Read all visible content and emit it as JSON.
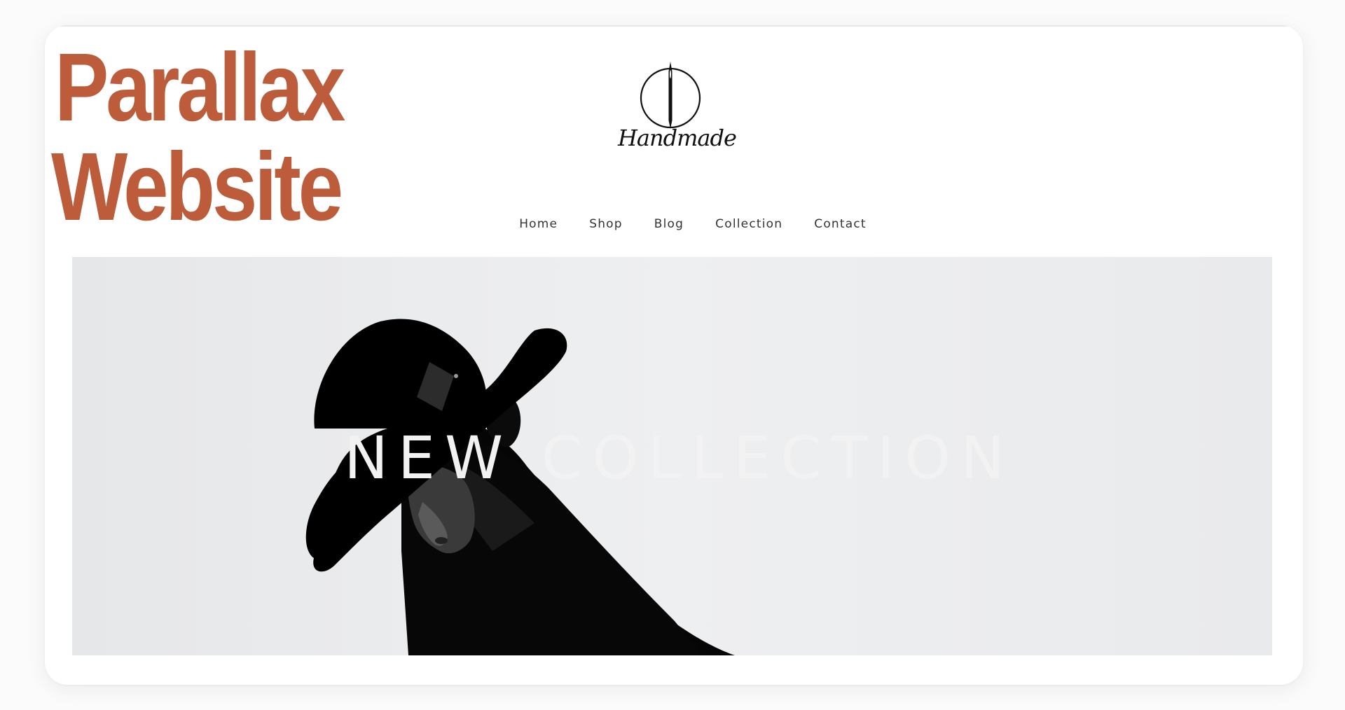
{
  "overlay": {
    "title_line1": "Parallax",
    "title_line2": "Website"
  },
  "brand": {
    "logo_text": "Handmade"
  },
  "nav": {
    "items": [
      "Home",
      "Shop",
      "Blog",
      "Collection",
      "Contact"
    ]
  },
  "hero": {
    "title": "NEW COLLECTION"
  },
  "colors": {
    "accent": "#bc5c3a",
    "hero_background": "#e9eaec",
    "hero_text": "#f2f2f2"
  }
}
